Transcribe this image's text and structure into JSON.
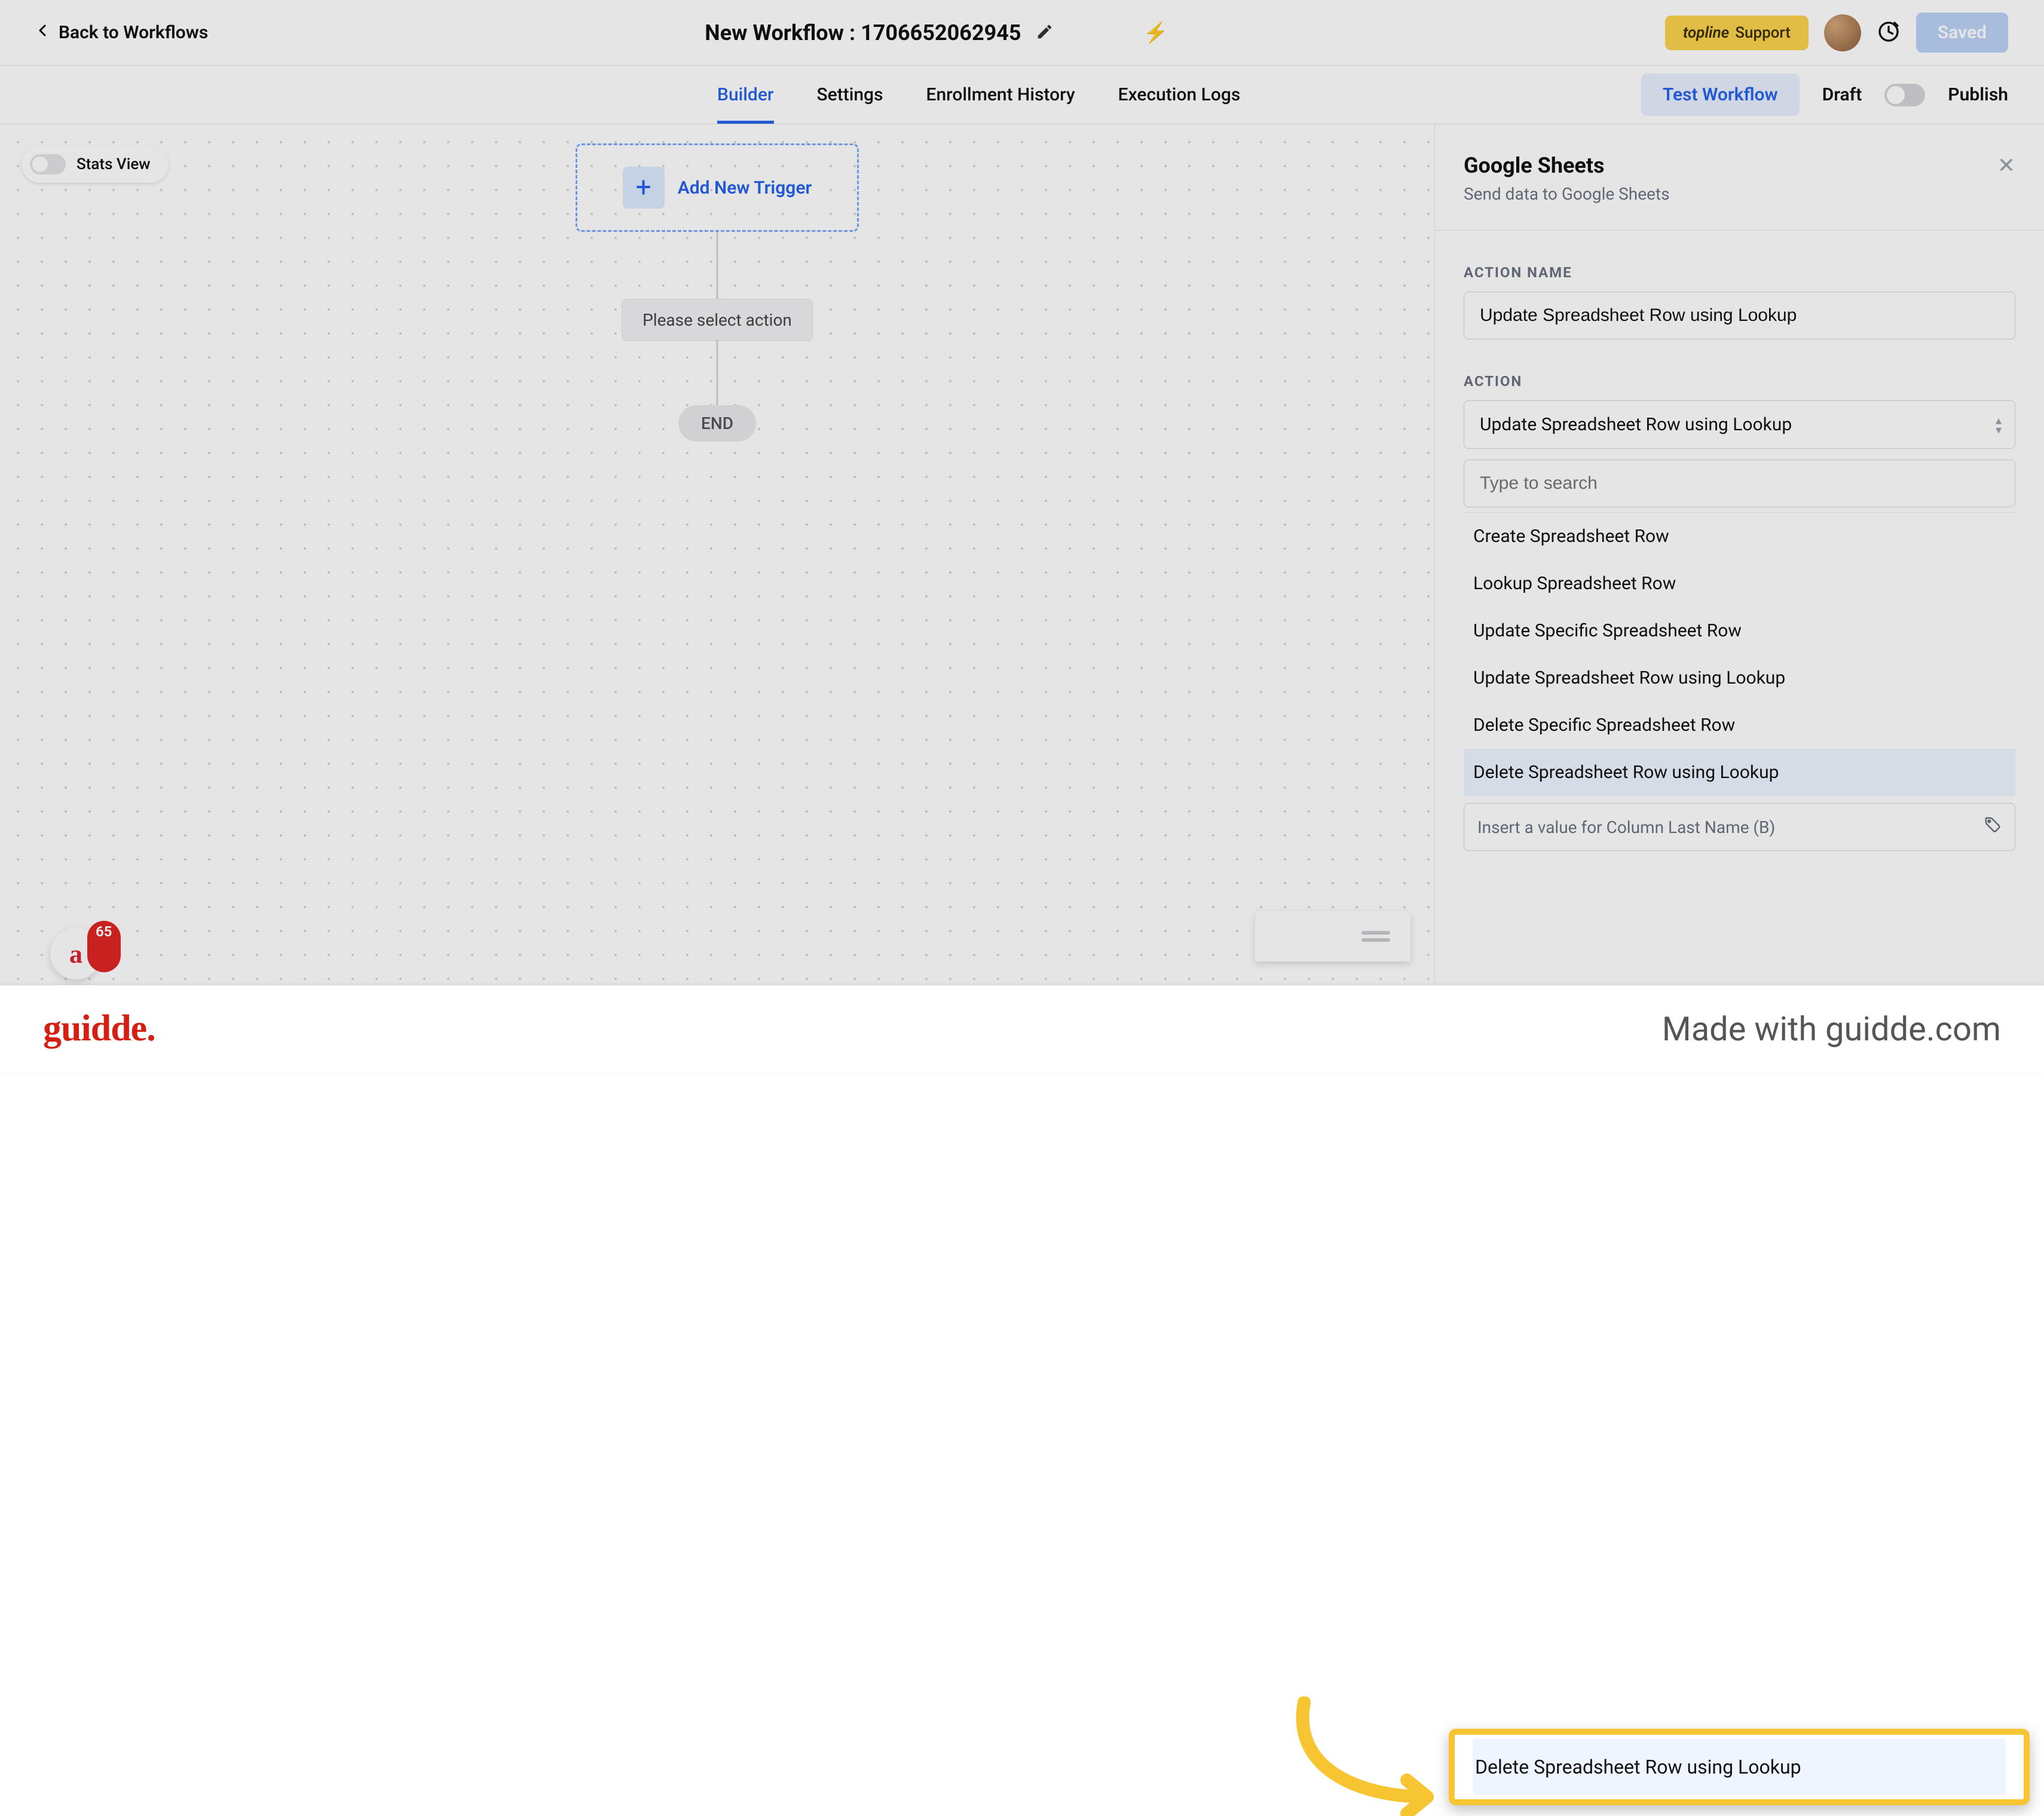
{
  "header": {
    "back_label": "Back to Workflows",
    "title": "New Workflow : 1706652062945",
    "support_brand": "topline",
    "support_label": "Support",
    "saved_label": "Saved"
  },
  "tabs": {
    "builder": "Builder",
    "settings": "Settings",
    "enrollment": "Enrollment History",
    "execution": "Execution Logs",
    "test_button": "Test Workflow",
    "draft": "Draft",
    "publish": "Publish"
  },
  "canvas": {
    "stats_view": "Stats View",
    "add_trigger": "Add New Trigger",
    "select_action": "Please select action",
    "end": "END",
    "notif_count": "65",
    "notif_letter": "a"
  },
  "panel": {
    "title": "Google Sheets",
    "subtitle": "Send data to Google Sheets",
    "action_name_label": "ACTION NAME",
    "action_name_value": "Update Spreadsheet Row using Lookup",
    "action_label": "ACTION",
    "action_value": "Update Spreadsheet Row using Lookup",
    "search_placeholder": "Type to search",
    "options": {
      "o0": "Create Spreadsheet Row",
      "o1": "Lookup Spreadsheet Row",
      "o2": "Update Specific Spreadsheet Row",
      "o3": "Update Spreadsheet Row using Lookup",
      "o4": "Delete Specific Spreadsheet Row",
      "o5": "Delete Spreadsheet Row using Lookup"
    },
    "value_placeholder": "Insert a value for Column Last Name  (B)"
  },
  "highlight": {
    "text": "Delete Spreadsheet Row using Lookup"
  },
  "footer": {
    "logo": "guidde.",
    "made_with": "Made with guidde.com"
  }
}
